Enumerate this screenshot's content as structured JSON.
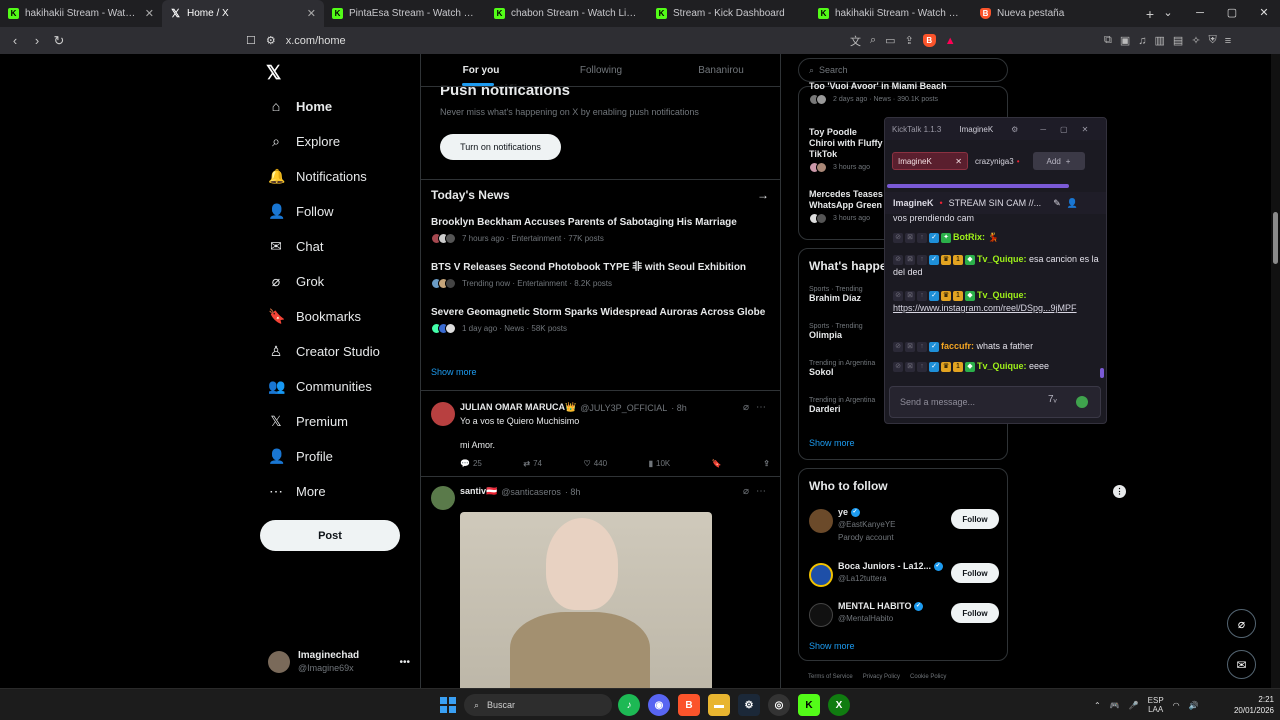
{
  "browser": {
    "tabs": [
      {
        "label": "hakihakii Stream - Watch Live on",
        "favicon": "kick-favicon",
        "active": false
      },
      {
        "label": "Home / X",
        "favicon": "x-favicon",
        "active": true
      },
      {
        "label": "PintaEsa Stream - Watch Live on",
        "favicon": "kick-favicon",
        "active": false
      },
      {
        "label": "chabon Stream - Watch Live on",
        "favicon": "kick-favicon",
        "active": false
      },
      {
        "label": "Stream - Kick Dashboard",
        "favicon": "kick-favicon",
        "active": false
      },
      {
        "label": "hakihakii Stream - Watch Live on",
        "favicon": "kick-favicon",
        "active": false
      },
      {
        "label": "Nueva pestaña",
        "favicon": "brave-favicon",
        "active": false
      }
    ],
    "url": "x.com/home"
  },
  "nav": {
    "items": [
      {
        "label": "Home",
        "icon": "home-icon",
        "glyph": "⌂"
      },
      {
        "label": "Explore",
        "icon": "search-icon",
        "glyph": "⌕"
      },
      {
        "label": "Notifications",
        "icon": "bell-icon",
        "glyph": "🔔"
      },
      {
        "label": "Follow",
        "icon": "person-plus-icon",
        "glyph": "👤"
      },
      {
        "label": "Chat",
        "icon": "mail-icon",
        "glyph": "✉"
      },
      {
        "label": "Grok",
        "icon": "grok-icon",
        "glyph": "⌀"
      },
      {
        "label": "Bookmarks",
        "icon": "bookmark-icon",
        "glyph": "🔖"
      },
      {
        "label": "Creator Studio",
        "icon": "creator-studio-icon",
        "glyph": "♙"
      },
      {
        "label": "Communities",
        "icon": "communities-icon",
        "glyph": "👥"
      },
      {
        "label": "Premium",
        "icon": "x-premium-icon",
        "glyph": "𝕏"
      },
      {
        "label": "Profile",
        "icon": "profile-icon",
        "glyph": "👤"
      },
      {
        "label": "More",
        "icon": "more-circle-icon",
        "glyph": "⋯"
      }
    ],
    "post_label": "Post",
    "account": {
      "name": "Imaginechad",
      "handle": "@Imagine69x"
    }
  },
  "feed": {
    "tabs": [
      "For you",
      "Following",
      "Bananirou"
    ],
    "push": {
      "title": "Push notifications",
      "subtitle": "Never miss what's happening on X by enabling push notifications",
      "button": "Turn on notifications"
    },
    "news": {
      "heading": "Today's News",
      "items": [
        {
          "title": "Brooklyn Beckham Accuses Parents of Sabotaging His Marriage",
          "meta": "7 hours ago · Entertainment · 77K posts"
        },
        {
          "title": "BTS V Releases Second Photobook TYPE 非 with Seoul Exhibition",
          "meta": "Trending now · Entertainment · 8.2K posts"
        },
        {
          "title": "Severe Geomagnetic Storm Sparks Widespread Auroras Across Globe",
          "meta": "1 day ago · News · 58K posts"
        }
      ],
      "show_more": "Show more"
    },
    "tweets": [
      {
        "name": "JULIAN OMAR MARUCA👑",
        "handle": "@JULY3P_OFFICIAL",
        "time": "· 8h",
        "line1": "Yo a vos te Quiero Muchisimo",
        "line2": "mi Amor.",
        "replies": "25",
        "reposts": "74",
        "likes": "440",
        "views": "10K"
      },
      {
        "name": "santiv🇦🇹",
        "handle": "@santicaseros",
        "time": "· 8h"
      }
    ]
  },
  "right": {
    "search_placeholder": "Search",
    "trending_top": {
      "title_cut": "Too 'Vuoi Avoor' in Miami Beach",
      "meta": "2 days ago · News · 390.1K posts"
    },
    "trending_cards": [
      {
        "title": "Toy Poodle Chiroi with Fluffy TikTok",
        "meta": "3 hours ago"
      },
      {
        "title": "Mercedes Teases WhatsApp Green",
        "meta": "3 hours ago"
      }
    ],
    "whats_happening": {
      "title": "What's happe",
      "trends": [
        {
          "ctx": "Sports · Trending",
          "title": "Brahim Díaz"
        },
        {
          "ctx": "Sports · Trending",
          "title": "Olimpia"
        },
        {
          "ctx": "Trending in Argentina",
          "title": "Sokol"
        },
        {
          "ctx": "Trending in Argentina",
          "title": "Darderi"
        }
      ],
      "show_more": "Show more"
    },
    "who_to_follow": {
      "title": "Who to follow",
      "accounts": [
        {
          "name": "ye",
          "handle": "@EastKanyeYE",
          "extra": "Parody account",
          "follow": "Follow"
        },
        {
          "name": "Boca Juniors - La12...",
          "handle": "@La12tuttera",
          "extra": "",
          "follow": "Follow"
        },
        {
          "name": "MENTAL HABITO",
          "handle": "@MentalHabito",
          "extra": "",
          "follow": "Follow"
        }
      ],
      "show_more": "Show more"
    },
    "footer": [
      "Terms of Service",
      "Privacy Policy",
      "Cookie Policy"
    ]
  },
  "kicktalk": {
    "app": "KickTalk 1.1.3",
    "user": "ImagineK",
    "channels": [
      "ImagineK",
      "crazyniga3"
    ],
    "add_label": "Add",
    "stream_user": "ImagineK",
    "stream_title": "STREAM SIN CAM //...",
    "cut_text": "vos prendiendo cam",
    "messages": [
      {
        "user": "BotRix:",
        "text": "",
        "badges": [
          "blue",
          "green"
        ]
      },
      {
        "user": "Tv_Quique:",
        "text": "esa cancion es la del ded",
        "badges": [
          "blue",
          "gold",
          "gold",
          "green"
        ]
      },
      {
        "user": "Tv_Quique:",
        "text": "https://www.instagram.com/reel/DSpg...9jMPF",
        "badges": [
          "blue",
          "gold",
          "gold",
          "green"
        ]
      },
      {
        "user": "faccufr:",
        "text": "whats a father",
        "badges": [
          "blue"
        ]
      },
      {
        "user": "Tv_Quique:",
        "text": "eeee",
        "badges": [
          "blue",
          "gold",
          "gold",
          "green"
        ]
      }
    ],
    "input_placeholder": "Send a message..."
  },
  "taskbar": {
    "search_label": "Buscar",
    "lang_1": "ESP",
    "lang_2": "LAA",
    "time": "2:21",
    "date": "20/01/2026"
  },
  "colors": {
    "accent": "#1d9bf0",
    "kick_green": "#53fc18",
    "kicktalk_purple": "#7b5ad6"
  }
}
